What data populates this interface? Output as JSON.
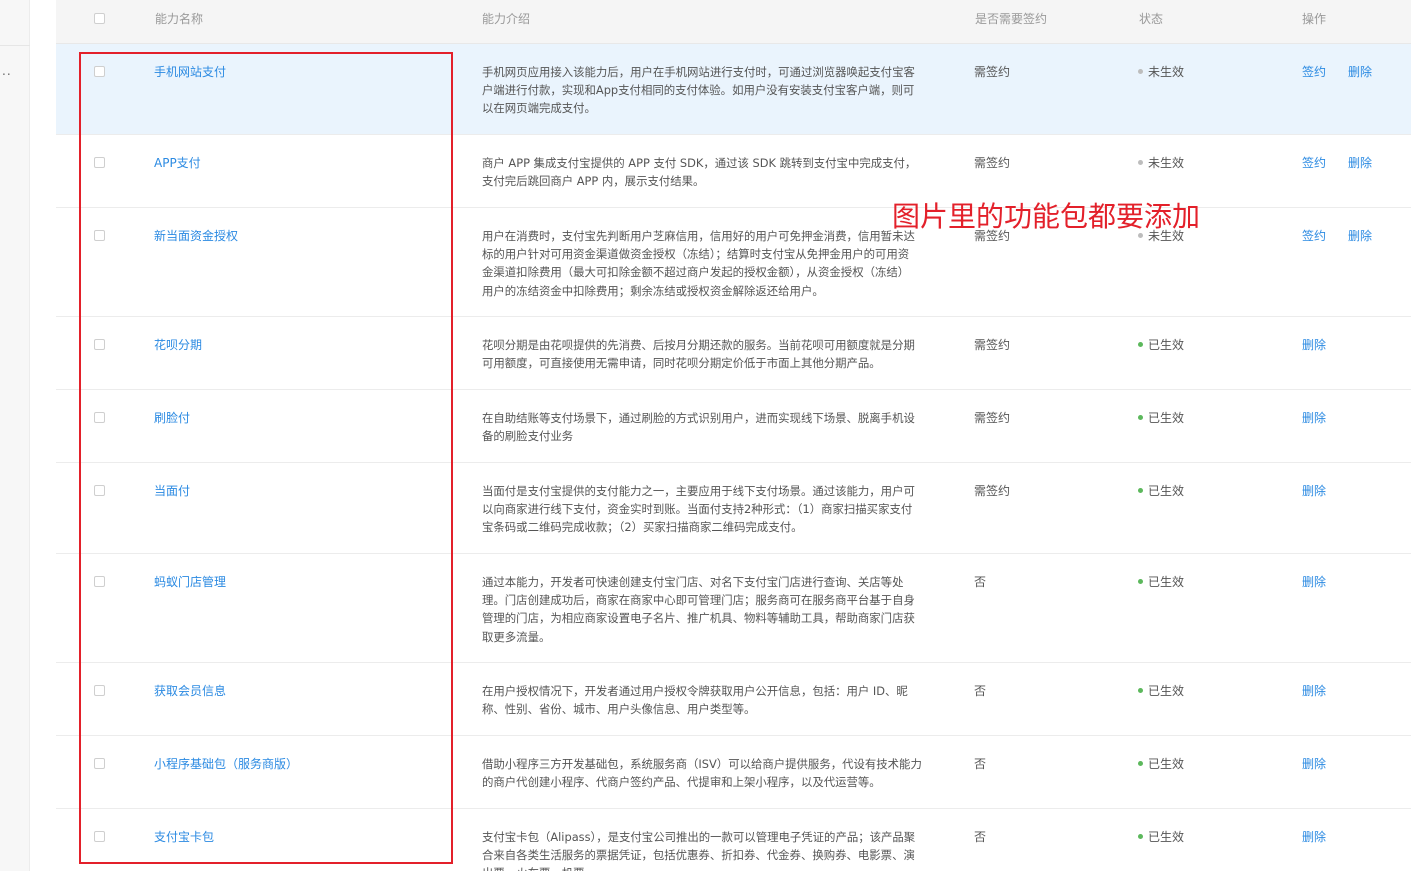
{
  "header": {
    "col_name": "能力名称",
    "col_desc": "能力介绍",
    "col_sign": "是否需要签约",
    "col_status": "状态",
    "col_op": "操作"
  },
  "left_nav": {
    "ellipsis": ".."
  },
  "rows": [
    {
      "name": "手机网站支付",
      "desc_lines": [
        "手机网页应用接入该能力后，用户在手机网站进行支付时，可通过浏览器唤起支付宝客",
        "户端进行付款，实现和App支付相同的支付体验。如用户没有安装支付宝客户端，则可",
        "以在网页端完成支付。"
      ],
      "sign": "需签约",
      "status": "未生效",
      "op1": "签约",
      "op2": "删除"
    },
    {
      "name": "APP支付",
      "desc_lines": [
        "商户 APP 集成支付宝提供的 APP 支付 SDK，通过该 SDK 跳转到支付宝中完成支付，",
        "支付完后跳回商户 APP 内，展示支付结果。"
      ],
      "sign": "需签约",
      "status": "未生效",
      "op1": "签约",
      "op2": "删除"
    },
    {
      "name": "新当面资金授权",
      "desc_lines": [
        "用户在消费时，支付宝先判断用户芝麻信用，信用好的用户可免押金消费，信用暂未达",
        "标的用户针对可用资金渠道做资金授权（冻结）；结算时支付宝从免押金用户的可用资",
        "金渠道扣除费用（最大可扣除金额不超过商户发起的授权金额），从资金授权（冻结）",
        "用户的冻结资金中扣除费用；剩余冻结或授权资金解除返还给用户。"
      ],
      "sign": "需签约",
      "status": "未生效",
      "op1": "签约",
      "op2": "删除"
    },
    {
      "name": "花呗分期",
      "desc_lines": [
        "花呗分期是由花呗提供的先消费、后按月分期还款的服务。当前花呗可用额度就是分期",
        "可用额度，可直接使用无需申请，同时花呗分期定价低于市面上其他分期产品。"
      ],
      "sign": "需签约",
      "status": "已生效",
      "op1": "删除",
      "op2": ""
    },
    {
      "name": "刷脸付",
      "desc_lines": [
        "在自助结账等支付场景下，通过刷脸的方式识别用户，进而实现线下场景、脱离手机设",
        "备的刷脸支付业务"
      ],
      "sign": "需签约",
      "status": "已生效",
      "op1": "删除",
      "op2": ""
    },
    {
      "name": "当面付",
      "desc_lines": [
        "当面付是支付宝提供的支付能力之一，主要应用于线下支付场景。通过该能力，用户可",
        "以向商家进行线下支付，资金实时到账。当面付支持2种形式：（1）商家扫描买家支付",
        "宝条码或二维码完成收款；（2）买家扫描商家二维码完成支付。"
      ],
      "sign": "需签约",
      "status": "已生效",
      "op1": "删除",
      "op2": ""
    },
    {
      "name": "蚂蚁门店管理",
      "desc_lines": [
        "通过本能力，开发者可快速创建支付宝门店、对名下支付宝门店进行查询、关店等处",
        "理。门店创建成功后，商家在商家中心即可管理门店；服务商可在服务商平台基于自身",
        "管理的门店，为相应商家设置电子名片、推广机具、物料等辅助工具，帮助商家门店获",
        "取更多流量。"
      ],
      "sign": "否",
      "status": "已生效",
      "op1": "删除",
      "op2": ""
    },
    {
      "name": "获取会员信息",
      "desc_lines": [
        "在用户授权情况下，开发者通过用户授权令牌获取用户公开信息，包括：用户 ID、昵",
        "称、性别、省份、城市、用户头像信息、用户类型等。"
      ],
      "sign": "否",
      "status": "已生效",
      "op1": "删除",
      "op2": ""
    },
    {
      "name": "小程序基础包（服务商版）",
      "desc_lines": [
        "借助小程序三方开发基础包，系统服务商（ISV）可以给商户提供服务，代设有技术能力",
        "的商户代创建小程序、代商户签约产品、代提审和上架小程序，以及代运营等。"
      ],
      "sign": "否",
      "status": "已生效",
      "op1": "删除",
      "op2": ""
    },
    {
      "name": "支付宝卡包",
      "desc_lines": [
        "支付宝卡包（Alipass），是支付宝公司推出的一款可以管理电子凭证的产品；该产品聚",
        "合来自各类生活服务的票据凭证，包括优惠券、折扣券、代金券、换购券、电影票、演",
        "出票、火车票、机票"
      ],
      "sign": "否",
      "status": "已生效",
      "op1": "删除",
      "op2": ""
    }
  ],
  "annotation": {
    "note": "图片里的功能包都要添加",
    "color": "#e3202a"
  },
  "colors": {
    "link": "#2b8ae2",
    "header_bg": "#f5f5f5",
    "highlight_row": "#eaf4fd",
    "status_active": "#5cb85c",
    "status_inactive": "#bdbdbd"
  }
}
